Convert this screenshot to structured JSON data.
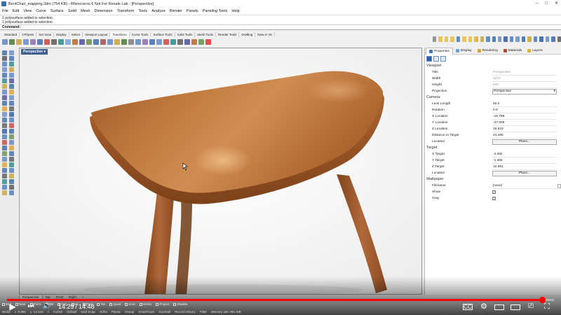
{
  "window": {
    "title": "BentChair_mapping.3dm (754 KB) - Rhinoceros 6 Not For Resale Lab - [Perspective]",
    "controls": [
      "–",
      "□",
      "✕"
    ]
  },
  "menu": [
    "File",
    "Edit",
    "View",
    "Curve",
    "Surface",
    "Solid",
    "Mesh",
    "Dimension",
    "Transform",
    "Tools",
    "Analyze",
    "Render",
    "Panels",
    "Paneling Tools",
    "Help"
  ],
  "command": {
    "history": [
      "1 polysurface added to selection.",
      "1 polysurface added to selection."
    ],
    "prompt": "Command:"
  },
  "toolbar_tabs": [
    "Standard",
    "CPlanes",
    "Set View",
    "Display",
    "Select",
    "Viewport Layout",
    "Transform",
    "Curve Tools",
    "Surface Tools",
    "Solid Tools",
    "Mesh Tools",
    "Render Tools",
    "Drafting",
    "New in V6"
  ],
  "toolbar_active_tab": "Transform",
  "viewport": {
    "label": "Perspective",
    "tabs": [
      "Perspective",
      "Top",
      "Front",
      "Right"
    ]
  },
  "properties": {
    "tabs": [
      "Properties",
      "Display",
      "Rendering",
      "Materials",
      "Layers"
    ],
    "tab_colors": [
      "#3b78c2",
      "#6aa0d8",
      "#e0a030",
      "#b04a3a",
      "#d8b040"
    ],
    "sections": {
      "viewport": "Viewport",
      "camera": "Camera",
      "target": "Target",
      "wallpaper": "Wallpaper"
    },
    "viewport_rows": [
      {
        "label": "Title",
        "value": "Perspective",
        "dim": true
      },
      {
        "label": "Width",
        "value": "1270",
        "dim": true
      },
      {
        "label": "Height",
        "value": "640",
        "dim": true
      },
      {
        "label": "Projection",
        "value": "Perspective",
        "type": "select"
      }
    ],
    "camera_rows": [
      {
        "label": "Lens Length",
        "value": "50.0"
      },
      {
        "label": "Rotation",
        "value": "0.0"
      },
      {
        "label": "X Location",
        "value": "-16.788"
      },
      {
        "label": "Y Location",
        "value": "-37.909"
      },
      {
        "label": "Z Location",
        "value": "15.623"
      },
      {
        "label": "Distance to Target",
        "value": "43.465"
      },
      {
        "label": "Location",
        "value": "Place...",
        "type": "button"
      }
    ],
    "target_rows": [
      {
        "label": "X Target",
        "value": "-2.292"
      },
      {
        "label": "Y Target",
        "value": "-1.466"
      },
      {
        "label": "Z Target",
        "value": "10.581"
      },
      {
        "label": "Location",
        "value": "Place...",
        "type": "button"
      }
    ],
    "wallpaper_rows": [
      {
        "label": "Filename",
        "value": "(none)"
      },
      {
        "label": "Show",
        "value": "✓"
      },
      {
        "label": "Gray",
        "value": "✓"
      }
    ]
  },
  "osnaps": [
    "End",
    "Near",
    "Point",
    "Mid",
    "Cen",
    "Int",
    "Perp",
    "Tan",
    "Quad",
    "Knot",
    "Vertex",
    "Project",
    "Disable"
  ],
  "status": [
    "World",
    "x -6.885",
    "y -14.516",
    "z",
    "Inches",
    "Default",
    "Grid Snap",
    "Ortho",
    "Planar",
    "Osnap",
    "SmartTrack",
    "Gumball",
    "Record History",
    "Filter",
    "Memory use: 991 MB"
  ],
  "video": {
    "current": "14:29",
    "separator": "/",
    "duration": "14:48",
    "progress": 0.978
  }
}
